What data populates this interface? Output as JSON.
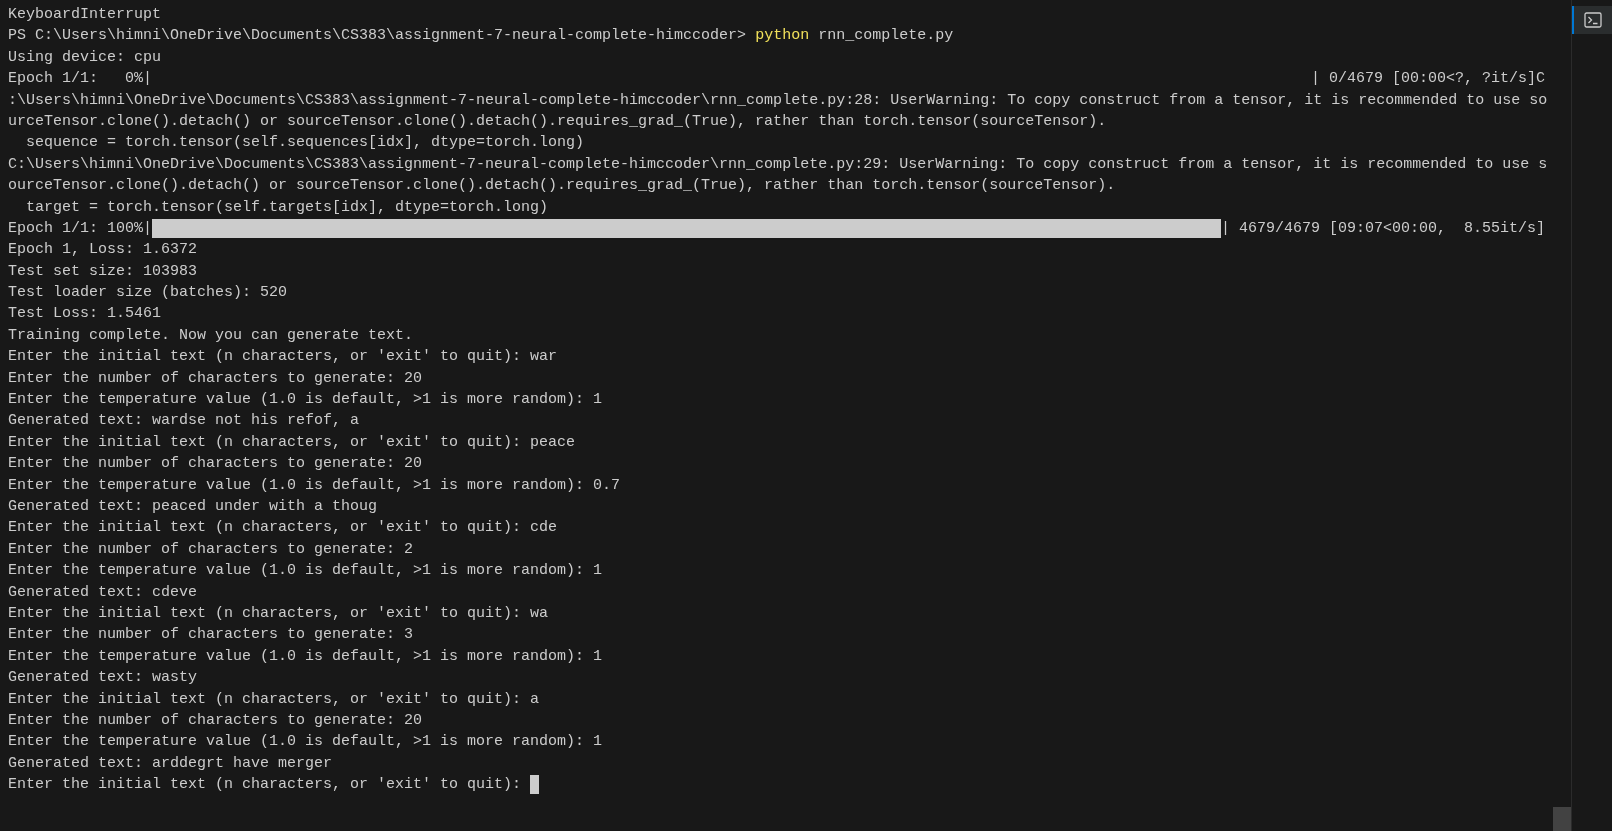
{
  "terminal": {
    "lines": [
      {
        "kind": "text",
        "text": "KeyboardInterrupt"
      },
      {
        "kind": "command",
        "prompt": "PS C:\\Users\\himni\\OneDrive\\Documents\\CS383\\assignment-7-neural-complete-himccoder>",
        "program": "python",
        "args": "rnn_complete.py"
      },
      {
        "kind": "text",
        "text": "Using device: cpu"
      },
      {
        "kind": "progress",
        "prefix": "Epoch 1/1:   0%|",
        "suffix": "| 0/4679 [00:00<?, ?it/s]C"
      },
      {
        "kind": "text",
        "text": ":\\Users\\himni\\OneDrive\\Documents\\CS383\\assignment-7-neural-complete-himccoder\\rnn_complete.py:28: UserWarning: To copy construct from a tensor, it is recommended to use so"
      },
      {
        "kind": "text",
        "text": "urceTensor.clone().detach() or sourceTensor.clone().detach().requires_grad_(True), rather than torch.tensor(sourceTensor)."
      },
      {
        "kind": "text",
        "text": "  sequence = torch.tensor(self.sequences[idx], dtype=torch.long)"
      },
      {
        "kind": "text",
        "text": "C:\\Users\\himni\\OneDrive\\Documents\\CS383\\assignment-7-neural-complete-himccoder\\rnn_complete.py:29: UserWarning: To copy construct from a tensor, it is recommended to use s"
      },
      {
        "kind": "text",
        "text": "ourceTensor.clone().detach() or sourceTensor.clone().detach().requires_grad_(True), rather than torch.tensor(sourceTensor)."
      },
      {
        "kind": "text",
        "text": "  target = torch.tensor(self.targets[idx], dtype=torch.long)"
      },
      {
        "kind": "progress",
        "prefix": "Epoch 1/1: 100%|",
        "complete": true,
        "suffix": "| 4679/4679 [09:07<00:00,  8.55it/s]"
      },
      {
        "kind": "text",
        "text": "Epoch 1, Loss: 1.6372"
      },
      {
        "kind": "text",
        "text": "Test set size: 103983"
      },
      {
        "kind": "text",
        "text": "Test loader size (batches): 520"
      },
      {
        "kind": "text",
        "text": "Test Loss: 1.5461"
      },
      {
        "kind": "text",
        "text": "Training complete. Now you can generate text."
      },
      {
        "kind": "text",
        "text": "Enter the initial text (n characters, or 'exit' to quit): war"
      },
      {
        "kind": "text",
        "text": "Enter the number of characters to generate: 20"
      },
      {
        "kind": "text",
        "text": "Enter the temperature value (1.0 is default, >1 is more random): 1"
      },
      {
        "kind": "text",
        "text": "Generated text: wardse not his refof, a"
      },
      {
        "kind": "text",
        "text": "Enter the initial text (n characters, or 'exit' to quit): peace"
      },
      {
        "kind": "text",
        "text": "Enter the number of characters to generate: 20"
      },
      {
        "kind": "text",
        "text": "Enter the temperature value (1.0 is default, >1 is more random): 0.7"
      },
      {
        "kind": "text",
        "text": "Generated text: peaced under with a thoug"
      },
      {
        "kind": "text",
        "text": "Enter the initial text (n characters, or 'exit' to quit): cde"
      },
      {
        "kind": "text",
        "text": "Enter the number of characters to generate: 2"
      },
      {
        "kind": "text",
        "text": "Enter the temperature value (1.0 is default, >1 is more random): 1"
      },
      {
        "kind": "text",
        "text": "Generated text: cdeve"
      },
      {
        "kind": "text",
        "text": "Enter the initial text (n characters, or 'exit' to quit): wa"
      },
      {
        "kind": "text",
        "text": "Enter the number of characters to generate: 3"
      },
      {
        "kind": "text",
        "text": "Enter the temperature value (1.0 is default, >1 is more random): 1"
      },
      {
        "kind": "text",
        "text": "Generated text: wasty"
      },
      {
        "kind": "text",
        "text": "Enter the initial text (n characters, or 'exit' to quit): a"
      },
      {
        "kind": "text",
        "text": "Enter the number of characters to generate: 20"
      },
      {
        "kind": "text",
        "text": "Enter the temperature value (1.0 is default, >1 is more random): 1"
      },
      {
        "kind": "text",
        "text": "Generated text: arddegrt have merger"
      },
      {
        "kind": "input",
        "text": "Enter the initial text (n characters, or 'exit' to quit):",
        "cursor": true
      }
    ]
  }
}
